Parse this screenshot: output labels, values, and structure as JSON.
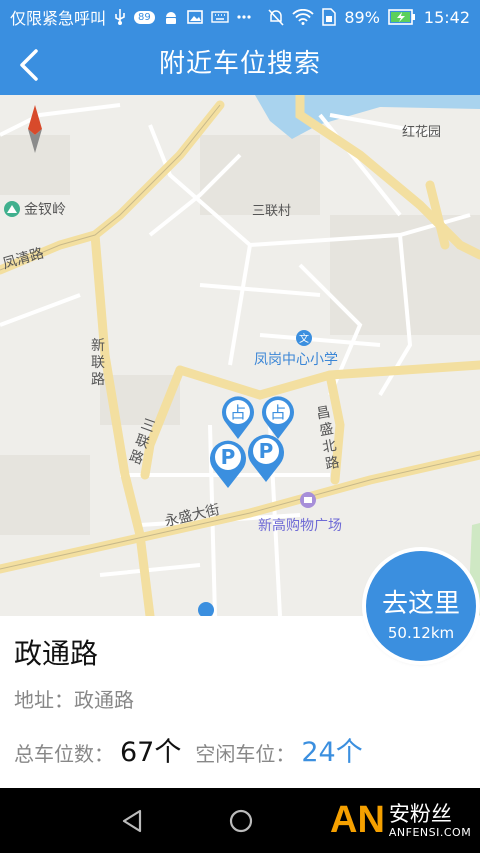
{
  "status_bar": {
    "carrier": "仅限紧急呼叫",
    "badge": "89",
    "battery": "89%",
    "time": "15:42"
  },
  "app_bar": {
    "title": "附近车位搜索"
  },
  "map": {
    "labels": {
      "jinzhailing": "金钗岭",
      "fengqing_road": "凤清路",
      "honghuayuan": "红花园",
      "sanlian_village": "三联村",
      "xinlian_road": "新联路",
      "fenggang_school": "凤岗中心小学",
      "changsheng_north": "昌盛北路",
      "sanlian_road": "三联路",
      "yongsheng_street": "永盛大街",
      "xingao_mall": "新高购物广场"
    },
    "markers": {
      "occupied_glyph": "占",
      "parking_glyph": "P"
    }
  },
  "go_button": {
    "label": "去这里",
    "distance": "50.12km"
  },
  "info": {
    "name": "政通路",
    "address_label": "地址：",
    "address": "政通路",
    "total_label": "总车位数：",
    "total": "67个",
    "free_label": "空闲车位：",
    "free": "24个"
  },
  "watermark": {
    "brand": "AN",
    "cn": "安粉丝",
    "en": "ANFENSI.COM"
  },
  "colors": {
    "primary": "#3a8fe0",
    "road": "#f3dfa0",
    "water": "#a9d3ee"
  }
}
